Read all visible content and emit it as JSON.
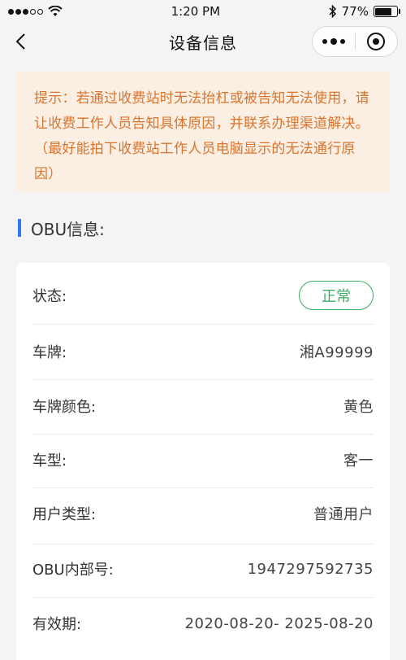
{
  "status_bar": {
    "time": "1:20 PM",
    "battery": "77%",
    "battery_level": 0.77,
    "icons": [
      "signal-dots-icon",
      "wifi-icon",
      "bluetooth-icon",
      "battery-icon"
    ]
  },
  "nav": {
    "title": "设备信息",
    "icons": [
      "back-chevron-icon",
      "more-dots-icon",
      "close-target-icon"
    ]
  },
  "notice": {
    "text": "提示：若通过收费站时无法抬杠或被告知无法使用，请让收费工作人员告知具体原因，并联系办理渠道解决。（最好能拍下收费站工作人员电脑显示的无法通行原因）"
  },
  "section": {
    "title": "OBU信息:"
  },
  "info": {
    "status_label": "状态:",
    "status_value": "正常",
    "plate_label": "车牌:",
    "plate_value": "湘A99999",
    "plate_color_label": "车牌颜色:",
    "plate_color_value": "黄色",
    "vehicle_type_label": "车型:",
    "vehicle_type_value": "客一",
    "user_type_label": "用户类型:",
    "user_type_value": "普通用户",
    "obu_id_label": "OBU内部号:",
    "obu_id_value": "1947297592735",
    "validity_label": "有效期:",
    "validity_value": "2020-08-20- 2025-08-20"
  },
  "colors": {
    "accent_blue": "#2f7bf4",
    "notice_bg": "#fbeee2",
    "notice_text": "#d9752f",
    "status_green": "#3aae62"
  }
}
